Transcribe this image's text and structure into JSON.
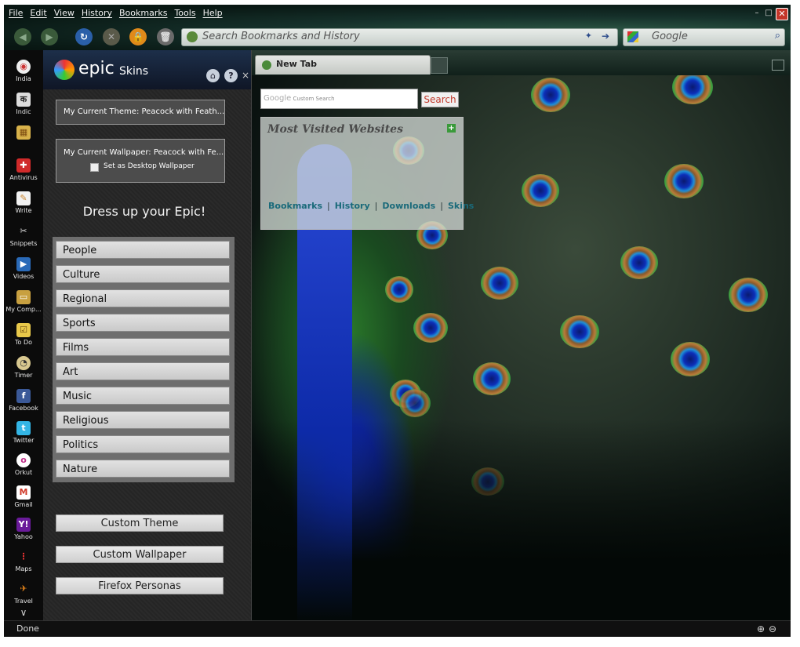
{
  "menu": [
    "File",
    "Edit",
    "View",
    "History",
    "Bookmarks",
    "Tools",
    "Help"
  ],
  "urlbar": {
    "placeholder": "Search Bookmarks and History"
  },
  "searchbar": {
    "placeholder": "Google"
  },
  "sidebar_icons": [
    {
      "label": "India",
      "icon": "india-icon"
    },
    {
      "label": "Indic",
      "icon": "indic-icon"
    },
    {
      "label": "",
      "icon": "skins-icon"
    },
    {
      "label": "Antivirus",
      "icon": "antivirus-icon"
    },
    {
      "label": "Write",
      "icon": "write-icon"
    },
    {
      "label": "Snippets",
      "icon": "scissors-icon"
    },
    {
      "label": "Videos",
      "icon": "videos-icon"
    },
    {
      "label": "My Comp...",
      "icon": "computer-icon"
    },
    {
      "label": "To Do",
      "icon": "todo-icon"
    },
    {
      "label": "Timer",
      "icon": "timer-icon"
    },
    {
      "label": "Facebook",
      "icon": "facebook-icon"
    },
    {
      "label": "Twitter",
      "icon": "twitter-icon"
    },
    {
      "label": "Orkut",
      "icon": "orkut-icon"
    },
    {
      "label": "Gmail",
      "icon": "gmail-icon"
    },
    {
      "label": "Yahoo",
      "icon": "yahoo-icon"
    },
    {
      "label": "Maps",
      "icon": "maps-icon"
    },
    {
      "label": "Travel",
      "icon": "travel-icon"
    }
  ],
  "skins_panel": {
    "brand": "epic",
    "title": "Skins",
    "current_theme": "My Current Theme: Peacock with Feath...",
    "current_wallpaper": "My Current Wallpaper: Peacock with Fe...",
    "desktop_wallpaper_label": "Set as Desktop Wallpaper",
    "tagline": "Dress up your Epic!",
    "categories": [
      "People",
      "Culture",
      "Regional",
      "Sports",
      "Films",
      "Art",
      "Music",
      "Religious",
      "Politics",
      "Nature"
    ],
    "custom_theme": "Custom Theme",
    "custom_wallpaper": "Custom Wallpaper",
    "firefox_personas": "Firefox Personas"
  },
  "tab": {
    "title": "New Tab"
  },
  "google_search": {
    "placeholder": "Custom Search",
    "button": "Search",
    "logo": "Google"
  },
  "most_visited": {
    "title": "Most Visited Websites",
    "links": [
      "Bookmarks",
      "History",
      "Downloads",
      "Skins"
    ]
  },
  "status": {
    "text": "Done"
  }
}
